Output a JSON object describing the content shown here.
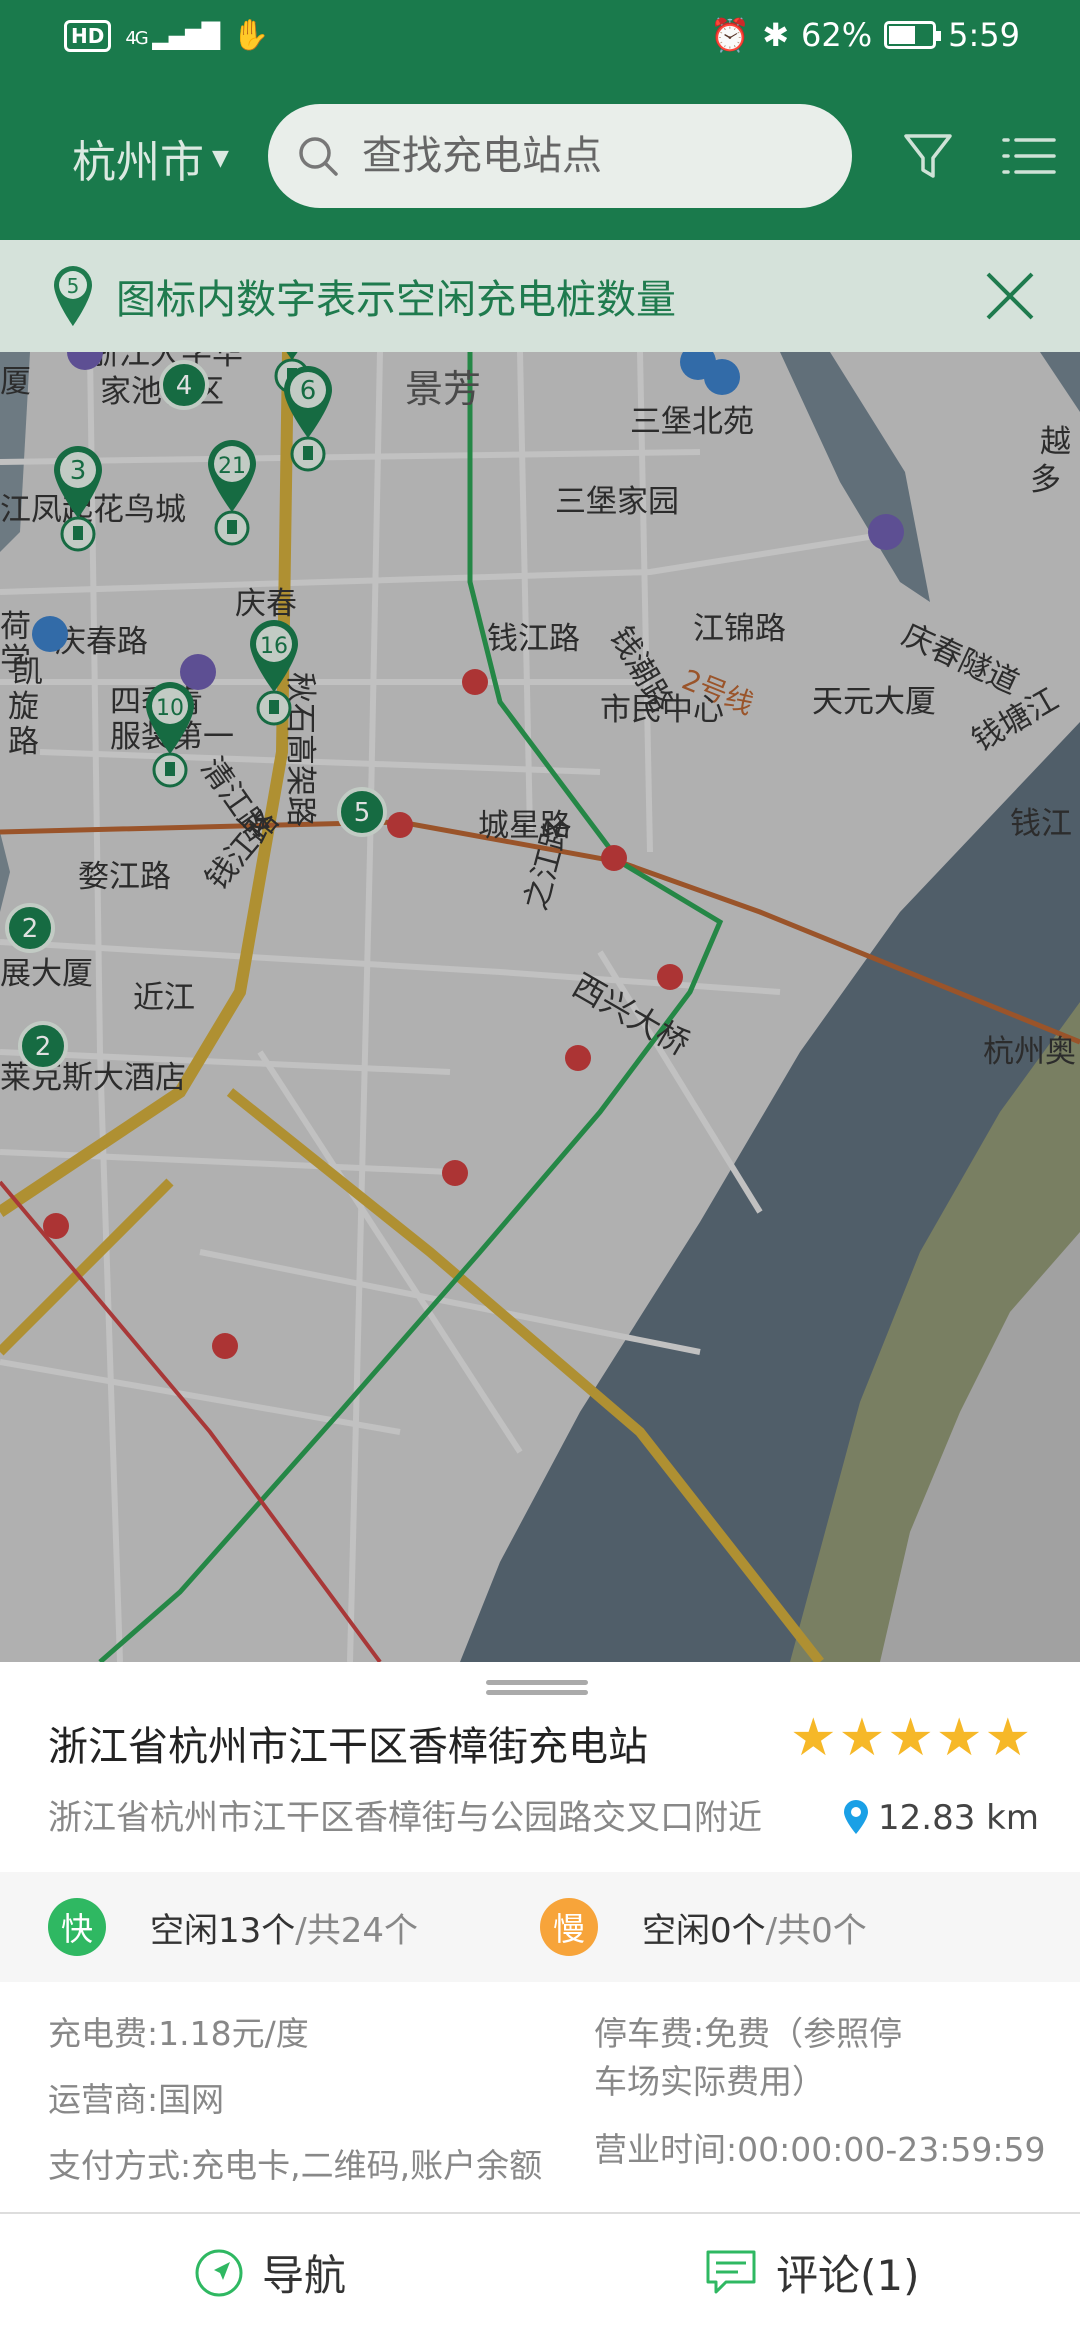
{
  "status_bar": {
    "hd": "HD",
    "network": "4G",
    "battery": "62%",
    "battery_level": 0.62,
    "time": "5:59"
  },
  "header": {
    "city": "杭州市",
    "search_placeholder": "查找充电站点"
  },
  "tip": {
    "pin_number": "5",
    "text": "图标内数字表示空闲充电桩数量"
  },
  "map": {
    "labels": {
      "zju": "浙江大学华",
      "zju2": "家池校区",
      "jingfang": "景芳",
      "sanbao_north": "三堡北苑",
      "yue": "越",
      "duo": "多",
      "hou": "厦",
      "fenghua": "江凤起花鸟城",
      "sanbao_home": "三堡家园",
      "qianchao": "钱潮路",
      "qingchun": "庆春",
      "qingchun_road": "庆春路",
      "qianjiang_road_station": "钱江路",
      "kai": "凯",
      "xuan": "旋",
      "lu": "路",
      "line2": "2号线",
      "tianyuan": "天元大厦",
      "qiantang": "钱塘江",
      "qiushi": "秋石高架路",
      "jiangjin": "江锦路",
      "qingchun_tunnel": "庆春隧道",
      "he": "荷",
      "xue": "学",
      "siji": "四季青",
      "fuzhuang": "服装第一",
      "shimin": "市民中心",
      "qingjiang": "清江路",
      "chengxing": "城星路",
      "qianjiang_right": "钱江",
      "wujiang": "婺江路",
      "qianjiang_road": "钱江路",
      "zhijiang": "之江路",
      "sha": "展大厦",
      "jinjiang": "近江",
      "xixing": "西兴大桥",
      "hangzhou_east": "杭州奥",
      "hotel": "莱克斯大酒店"
    },
    "pins": [
      {
        "count": "6",
        "type": "outline"
      },
      {
        "count": "6",
        "type": "outline"
      },
      {
        "count": "6",
        "type": "outline"
      },
      {
        "count": "4",
        "type": "solid"
      },
      {
        "count": "3",
        "type": "outline"
      },
      {
        "count": "21",
        "type": "outline"
      },
      {
        "count": "16",
        "type": "outline"
      },
      {
        "count": "10",
        "type": "outline"
      },
      {
        "count": "5",
        "type": "solid"
      },
      {
        "count": "2",
        "type": "solid"
      },
      {
        "count": "2",
        "type": "solid"
      }
    ],
    "colors": {
      "land": "#c9c9c9",
      "water": "#5c6b78",
      "green": "#1a7a4c"
    }
  },
  "station": {
    "name": "浙江省杭州市江干区香樟街充电站",
    "rating": 5,
    "stars": "★★★★★",
    "address": "浙江省杭州市江干区香樟街与公园路交叉口附近",
    "distance": "12.83 km",
    "fast": {
      "badge": "快",
      "free": "空闲13个",
      "total": "/共24个",
      "color": "#2fb862"
    },
    "slow": {
      "badge": "慢",
      "free": "空闲0个",
      "total": "/共0个",
      "color": "#f7a43a"
    },
    "fee": "充电费:1.18元/度",
    "operator": "运营商:国网",
    "payment": "支付方式:充电卡,二维码,账户余额",
    "parking_line1": "停车费:免费（参照停",
    "parking_line2": "车场实际费用）",
    "hours": "营业时间:00:00:00-23:59:59"
  },
  "actions": {
    "navigate": "导航",
    "comments": "评论(1)"
  }
}
